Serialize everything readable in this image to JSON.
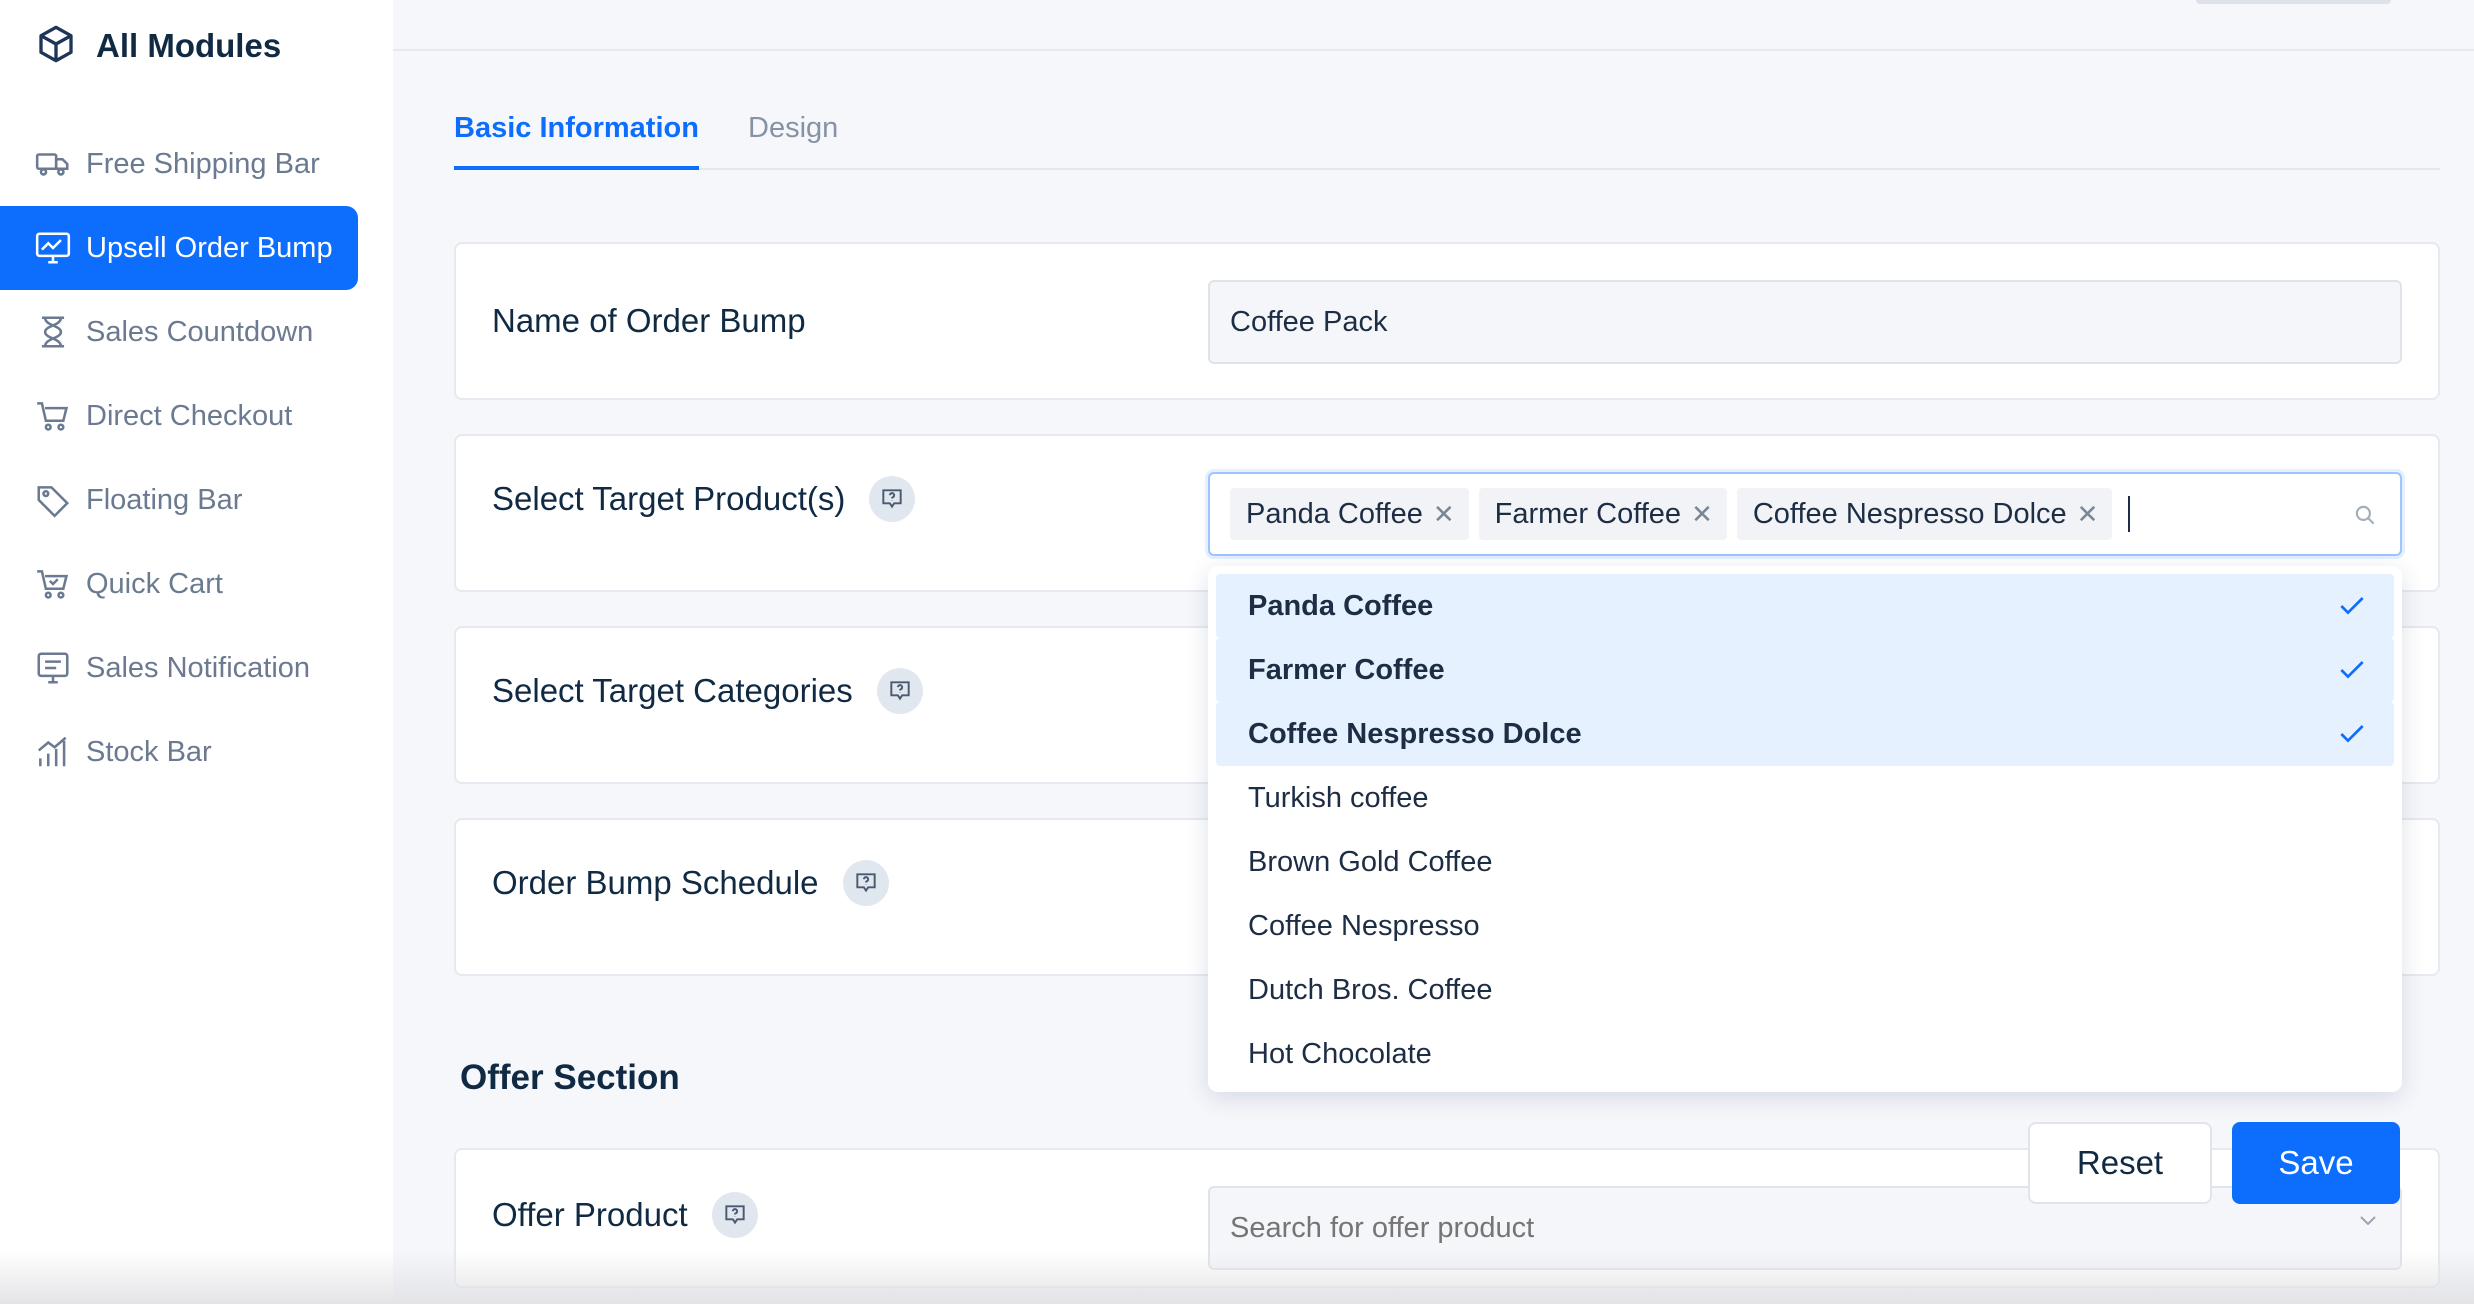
{
  "sidebar": {
    "brand": {
      "title": "All Modules",
      "icon": "cube-icon"
    },
    "items": [
      {
        "label": "Free Shipping Bar",
        "icon": "truck-icon",
        "active": false
      },
      {
        "label": "Upsell Order Bump",
        "icon": "chart-monitor-icon",
        "active": true
      },
      {
        "label": "Sales Countdown",
        "icon": "hourglass-icon",
        "active": false
      },
      {
        "label": "Direct Checkout",
        "icon": "cart-icon",
        "active": false
      },
      {
        "label": "Floating Bar",
        "icon": "tag-icon",
        "active": false
      },
      {
        "label": "Quick Cart",
        "icon": "cart-check-icon",
        "active": false
      },
      {
        "label": "Sales Notification",
        "icon": "notification-icon",
        "active": false
      },
      {
        "label": "Stock Bar",
        "icon": "bar-chart-icon",
        "active": false
      }
    ]
  },
  "tabs": [
    {
      "label": "Basic Information",
      "active": true
    },
    {
      "label": "Design",
      "active": false
    }
  ],
  "form": {
    "name": {
      "label": "Name of Order Bump",
      "value": "Coffee Pack"
    },
    "target_products": {
      "label": "Select Target Product(s)",
      "selected": [
        "Panda Coffee",
        "Farmer Coffee",
        "Coffee Nespresso Dolce"
      ]
    },
    "target_categories": {
      "label": "Select Target Categories"
    },
    "schedule": {
      "label": "Order Bump Schedule"
    },
    "offer_section_title": "Offer Section",
    "offer_product": {
      "label": "Offer Product",
      "placeholder": "Search for offer product"
    }
  },
  "dropdown": {
    "options": [
      {
        "label": "Panda Coffee",
        "selected": true
      },
      {
        "label": "Farmer Coffee",
        "selected": true
      },
      {
        "label": "Coffee Nespresso Dolce",
        "selected": true
      },
      {
        "label": "Turkish coffee",
        "selected": false
      },
      {
        "label": "Brown Gold Coffee",
        "selected": false
      },
      {
        "label": "Coffee Nespresso",
        "selected": false
      },
      {
        "label": "Dutch Bros. Coffee",
        "selected": false
      },
      {
        "label": "Hot Chocolate",
        "selected": false
      }
    ]
  },
  "actions": {
    "reset_label": "Reset",
    "save_label": "Save"
  },
  "colors": {
    "accent": "#0d6efd",
    "selected_bg": "#e6f1ff"
  }
}
